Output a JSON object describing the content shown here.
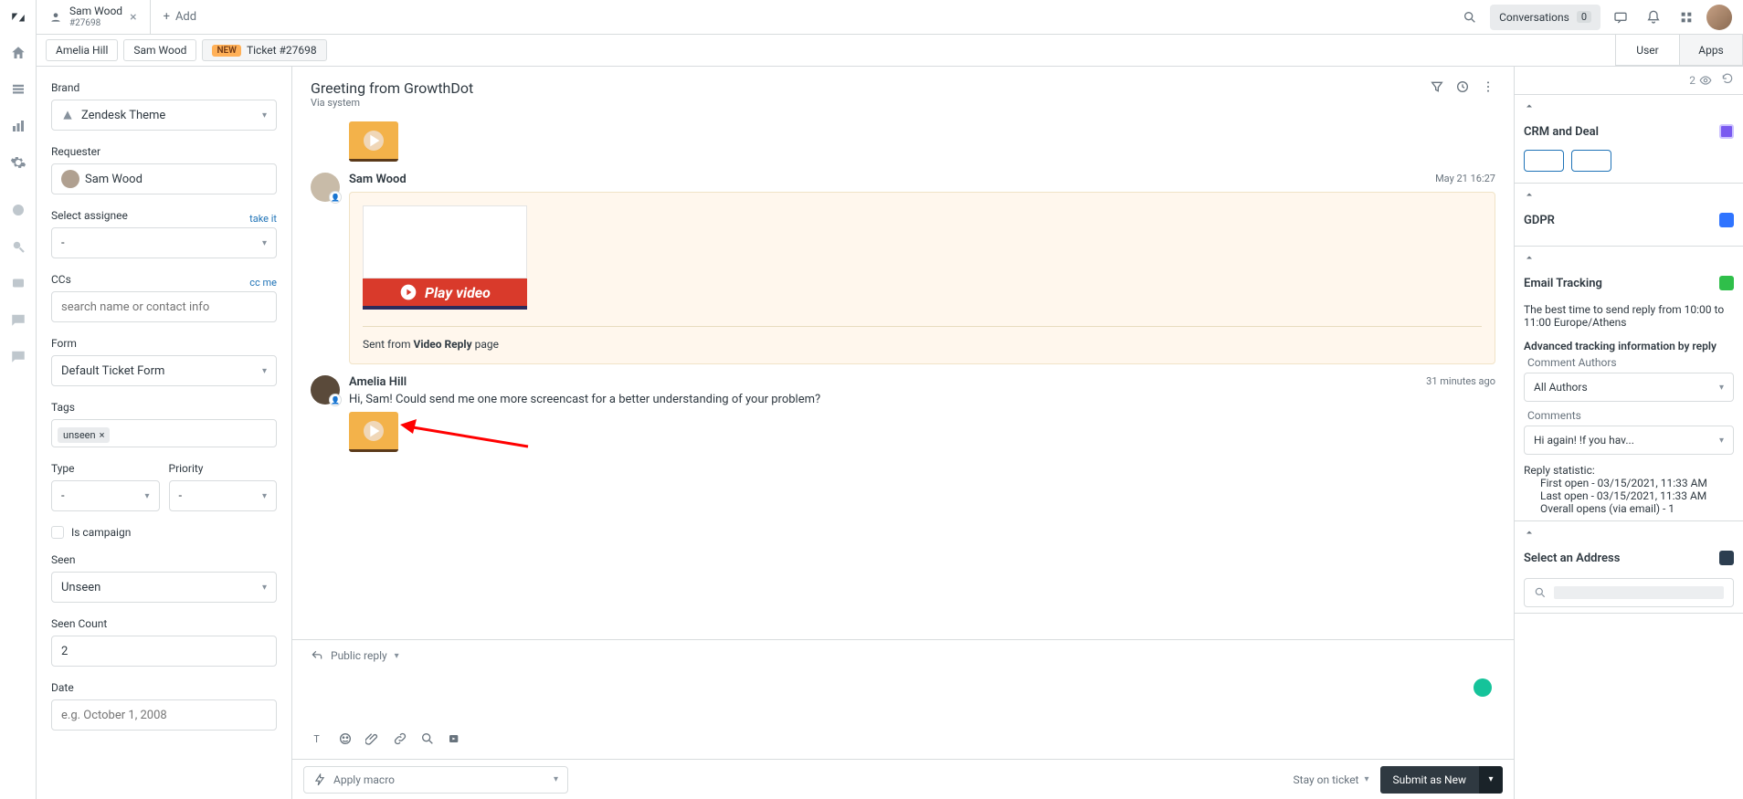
{
  "header": {
    "tab": {
      "name": "Sam Wood",
      "sub": "#27698"
    },
    "add": "Add",
    "conversations_label": "Conversations",
    "conversations_count": "0"
  },
  "user_tabs": {
    "t1": "Amelia Hill",
    "t2": "Sam Wood",
    "new_label": "NEW",
    "ticket": "Ticket #27698"
  },
  "rightpair": {
    "user": "User",
    "apps": "Apps"
  },
  "details": {
    "brand": {
      "label": "Brand",
      "value": "Zendesk Theme"
    },
    "requester": {
      "label": "Requester",
      "value": "Sam Wood"
    },
    "assignee": {
      "label": "Select assignee",
      "value": "-",
      "link": "take it"
    },
    "ccs": {
      "label": "CCs",
      "placeholder": "search name or contact info",
      "link": "cc me"
    },
    "form": {
      "label": "Form",
      "value": "Default Ticket Form"
    },
    "tags": {
      "label": "Tags",
      "chip": "unseen"
    },
    "type": {
      "label": "Type",
      "value": "-"
    },
    "priority": {
      "label": "Priority",
      "value": "-"
    },
    "campaign": "Is campaign",
    "seen": {
      "label": "Seen",
      "value": "Unseen"
    },
    "seen_count": {
      "label": "Seen Count",
      "value": "2"
    },
    "date": {
      "label": "Date",
      "placeholder": "e.g. October 1, 2008"
    }
  },
  "conv": {
    "title": "Greeting from GrowthDot",
    "via": "Via system",
    "msg1": {
      "name": "Sam Wood",
      "time": "May 21 16:27",
      "play": "Play video",
      "sent": "Sent from ",
      "link": "Video Reply",
      "page": " page"
    },
    "msg2": {
      "name": "Amelia Hill",
      "time": "31 minutes ago",
      "body": "Hi, Sam! Could send me one more screencast for a better understanding of your problem?"
    }
  },
  "reply": {
    "mode": "Public reply"
  },
  "bottom": {
    "macro": "Apply macro",
    "stay": "Stay on ticket",
    "submit": "Submit as New"
  },
  "apps": {
    "views_count": "2",
    "crm": {
      "title": "CRM and Deal"
    },
    "gdpr": {
      "title": "GDPR"
    },
    "email": {
      "title": "Email Tracking",
      "best": "The best time to send reply from 10:00 to 11:00 Europe/Athens",
      "adv": "Advanced tracking information by reply",
      "authors_label": "Comment Authors",
      "authors_value": "All Authors",
      "comments_label": "Comments",
      "comments_value": "Hi again! !f you hav...",
      "stats_h": "Reply statistic:",
      "first": "First open - 03/15/2021, 11:33 AM",
      "last": "Last open - 03/15/2021, 11:33 AM",
      "overall": "Overall opens (via email) - 1"
    },
    "address": {
      "title": "Select an Address"
    }
  }
}
